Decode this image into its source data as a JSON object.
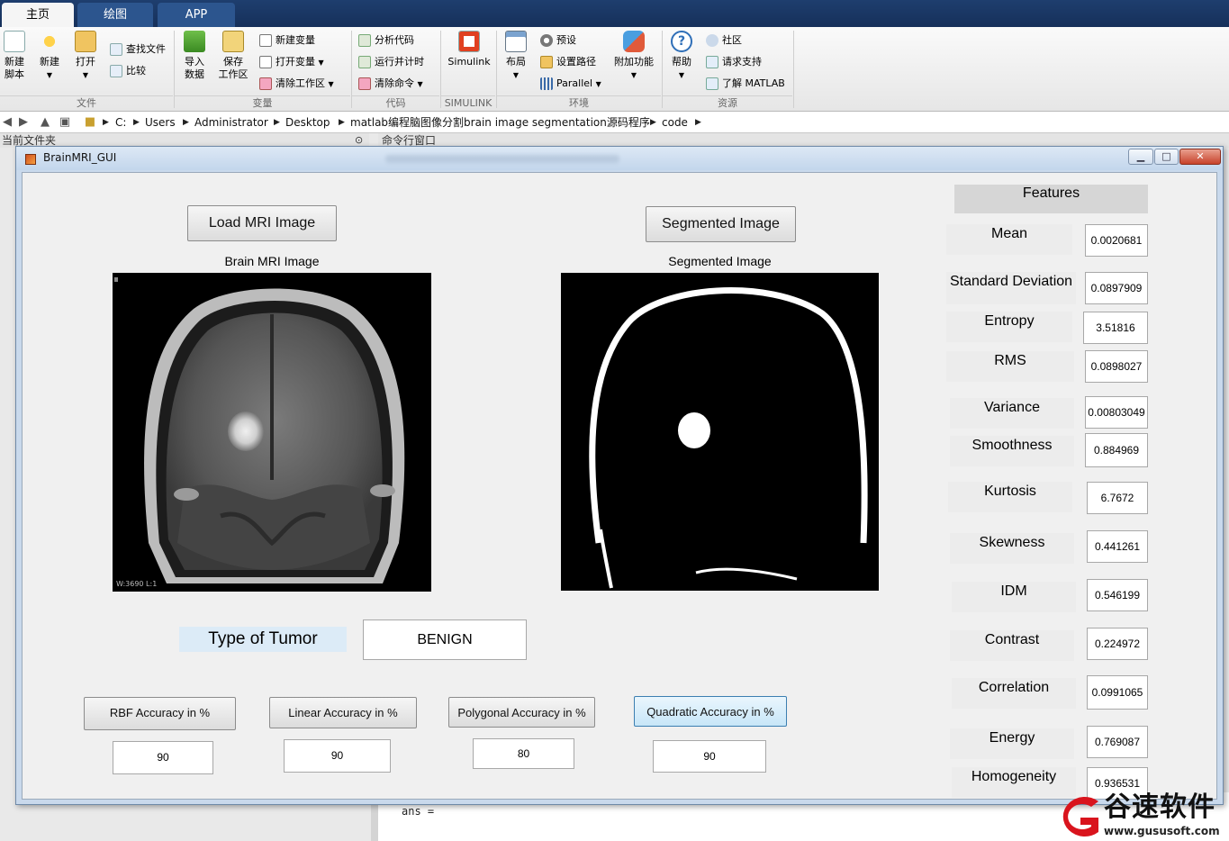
{
  "matlab": {
    "tabs": [
      "主页",
      "绘图",
      "APP"
    ],
    "ribbon": {
      "new_script": "新建\n脚本",
      "new": "新建",
      "open": "打开",
      "find_files": "查找文件",
      "compare": "比较",
      "group_file": "文件",
      "import_data": "导入\n数据",
      "save_workspace": "保存\n工作区",
      "new_variable": "新建变量",
      "open_variable": "打开变量",
      "clear_workspace": "清除工作区",
      "group_variable": "变量",
      "analyze_code": "分析代码",
      "run_and_time": "运行并计时",
      "clear_commands": "清除命令",
      "group_code": "代码",
      "simulink": "Simulink",
      "group_simulink": "SIMULINK",
      "layout": "布局",
      "preferences": "预设",
      "set_path": "设置路径",
      "parallel": "Parallel",
      "group_environment": "环境",
      "addons": "附加功能",
      "help": "帮助",
      "community": "社区",
      "request_support": "请求支持",
      "learn_matlab": "了解 MATLAB",
      "group_resources": "资源"
    },
    "path": [
      "C:",
      "Users",
      "Administrator",
      "Desktop",
      "matlab编程脑图像分割brain image segmentation源码程序",
      "code"
    ],
    "current_folder_label": "当前文件夹",
    "command_window_label": "命令行窗口",
    "command_text": "ans ="
  },
  "gui": {
    "title": "BrainMRI_GUI",
    "load_button": "Load MRI Image",
    "segment_button": "Segmented Image",
    "brain_axes_title": "Brain MRI Image",
    "segmented_axes_title": "Segmented Image",
    "features_header": "Features",
    "features": [
      {
        "label": "Mean",
        "value": "0.0020681"
      },
      {
        "label": "Standard Deviation",
        "value": "0.0897909"
      },
      {
        "label": "Entropy",
        "value": "3.51816"
      },
      {
        "label": "RMS",
        "value": "0.0898027"
      },
      {
        "label": "Variance",
        "value": "0.00803049"
      },
      {
        "label": "Smoothness",
        "value": "0.884969"
      },
      {
        "label": "Kurtosis",
        "value": "6.7672"
      },
      {
        "label": "Skewness",
        "value": "0.441261"
      },
      {
        "label": "IDM",
        "value": "0.546199"
      },
      {
        "label": "Contrast",
        "value": "0.224972"
      },
      {
        "label": "Correlation",
        "value": "0.0991065"
      },
      {
        "label": "Energy",
        "value": "0.769087"
      },
      {
        "label": "Homogeneity",
        "value": "0.936531"
      }
    ],
    "tumor_label": "Type of Tumor",
    "tumor_value": "BENIGN",
    "accuracy": [
      {
        "label": "RBF Accuracy in %",
        "value": "90"
      },
      {
        "label": "Linear Accuracy in %",
        "value": "90"
      },
      {
        "label": "Polygonal Accuracy in %",
        "value": "80"
      },
      {
        "label": "Quadratic Accuracy in %",
        "value": "90"
      }
    ],
    "mri_overlay_text": "W:3690 L:1"
  },
  "watermark": {
    "brand": "谷速软件",
    "url": "www.gususoft.com"
  },
  "colors": {
    "accent_blue": "#3c7fb1",
    "ribbon_tab": "#16305a",
    "watermark_red": "#d9141d"
  }
}
